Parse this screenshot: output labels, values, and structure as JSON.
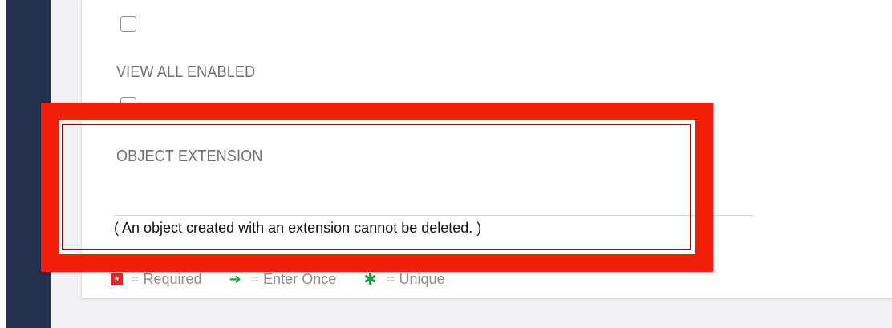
{
  "fields": [
    {
      "id": "top",
      "label": "",
      "checked": false
    },
    {
      "id": "view_all_enabled",
      "label": "VIEW ALL ENABLED",
      "checked": false
    },
    {
      "id": "object_extension",
      "label": "OBJECT EXTENSION",
      "value": ""
    }
  ],
  "note": "( An object created with an extension cannot be deleted. )",
  "legend": {
    "required": "= Required",
    "enter_once": "= Enter Once",
    "unique": "= Unique"
  },
  "colors": {
    "sidebar": "#22304c",
    "highlight": "#f22008",
    "required": "#e0262a",
    "green": "#1f9a45"
  },
  "icons": {
    "required": "required-icon",
    "enter_once": "arrow-right-icon",
    "unique": "asterisk-icon"
  }
}
